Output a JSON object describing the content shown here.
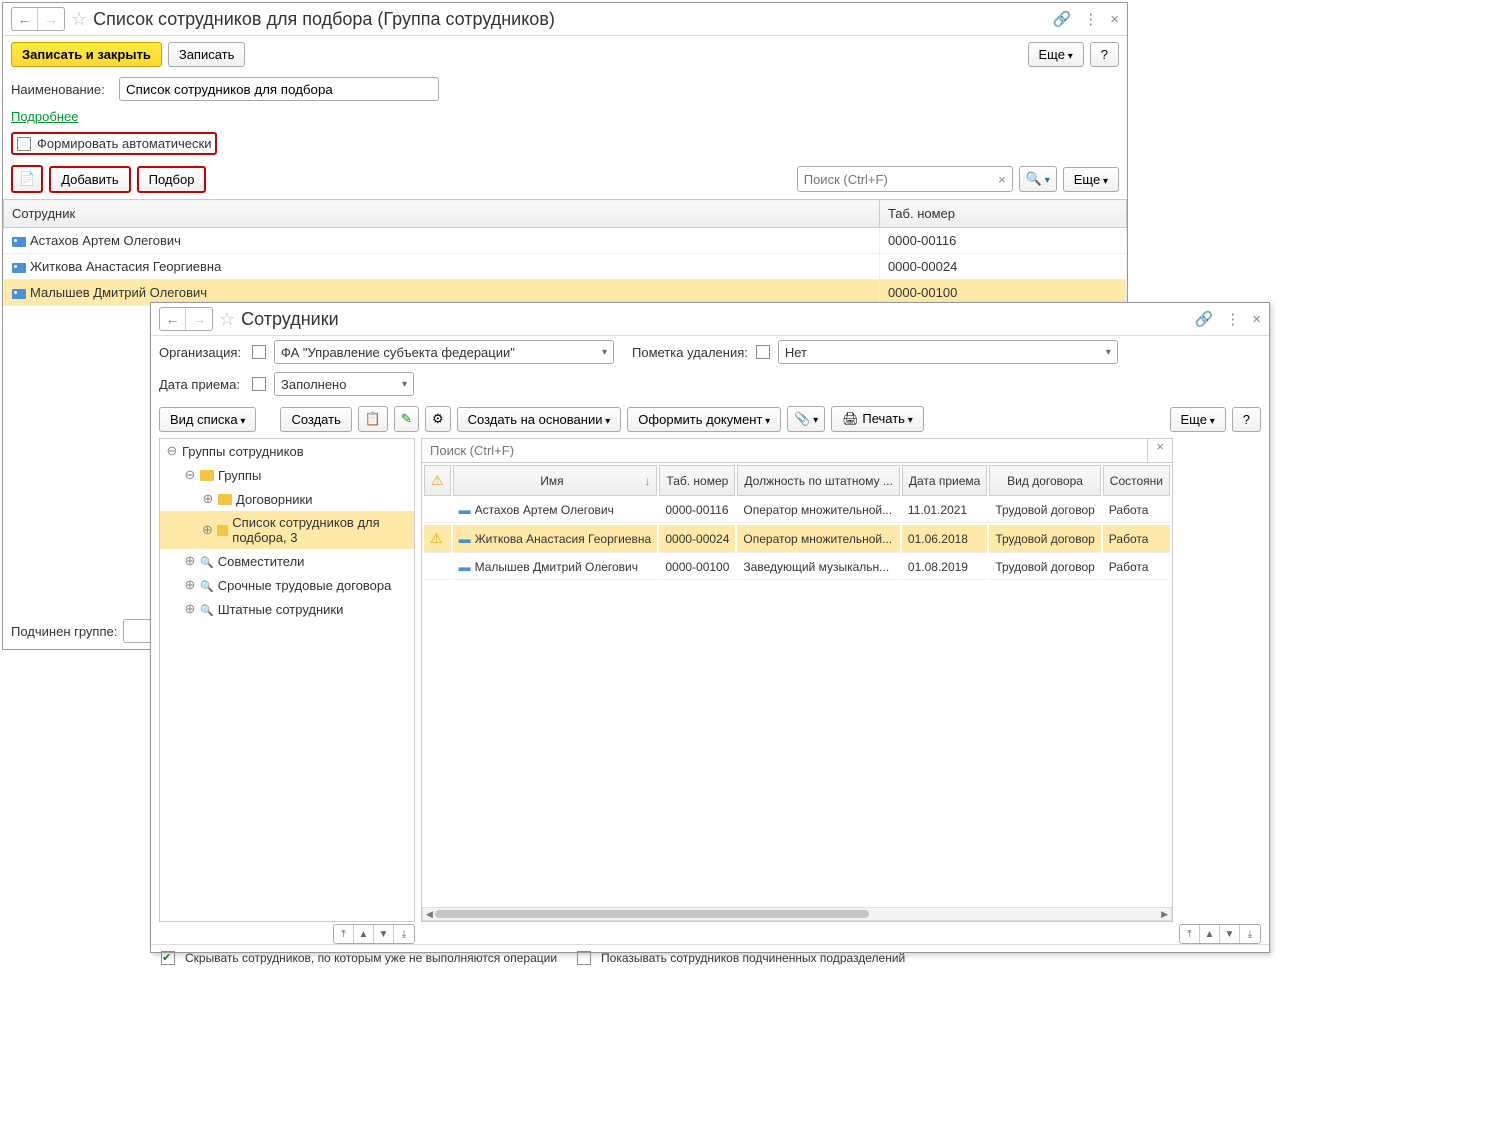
{
  "win1": {
    "title": "Список сотрудников для подбора (Группа сотрудников)",
    "save_close": "Записать и закрыть",
    "save": "Записать",
    "more": "Еще",
    "name_label": "Наименование:",
    "name_value": "Список сотрудников для подбора",
    "details_link": "Подробнее",
    "auto_label": "Формировать автоматически",
    "add": "Добавить",
    "pick": "Подбор",
    "search_ph": "Поиск (Ctrl+F)",
    "col_emp": "Сотрудник",
    "col_tab": "Таб. номер",
    "rows": [
      {
        "name": "Астахов Артем Олегович",
        "tab": "0000-00116"
      },
      {
        "name": "Житкова Анастасия Георгиевна",
        "tab": "0000-00024"
      },
      {
        "name": "Малышев Дмитрий Олегович",
        "tab": "0000-00100"
      }
    ],
    "group_label": "Подчинен группе:"
  },
  "win2": {
    "title": "Сотрудники",
    "org_label": "Организация:",
    "org_value": "ФА \"Управление субъекта федерации\"",
    "del_label": "Пометка удаления:",
    "del_value": "Нет",
    "hired_label": "Дата приема:",
    "hired_value": "Заполнено",
    "listview": "Вид списка",
    "create": "Создать",
    "create_based": "Создать на основании",
    "make_doc": "Оформить документ",
    "print": "Печать",
    "more": "Еще",
    "search_ph": "Поиск (Ctrl+F)",
    "tree": {
      "root": "Группы сотрудников",
      "items": [
        {
          "label": "Группы",
          "depth": 1,
          "folder": true,
          "exp": "⊖"
        },
        {
          "label": "Договорники",
          "depth": 2,
          "folder": true,
          "exp": "⊕"
        },
        {
          "label": "Список сотрудников для подбора, 3",
          "depth": 2,
          "folder": true,
          "exp": "⊕",
          "sel": true
        },
        {
          "label": "Совместители",
          "depth": 1,
          "lens": true,
          "exp": "⊕"
        },
        {
          "label": "Срочные трудовые договора",
          "depth": 1,
          "lens": true,
          "exp": "⊕"
        },
        {
          "label": "Штатные сотрудники",
          "depth": 1,
          "lens": true,
          "exp": "⊕"
        }
      ]
    },
    "cols": [
      "Имя",
      "Таб. номер",
      "Должность по штатному ...",
      "Дата приема",
      "Вид договора",
      "Состояни"
    ],
    "rows": [
      {
        "name": "Астахов Артем Олегович",
        "tab": "0000-00116",
        "pos": "Оператор множительной...",
        "date": "11.01.2021",
        "contract": "Трудовой договор",
        "state": "Работа"
      },
      {
        "name": "Житкова Анастасия Георгиевна",
        "tab": "0000-00024",
        "pos": "Оператор множительной...",
        "date": "01.06.2018",
        "contract": "Трудовой договор",
        "state": "Работа",
        "sel": true,
        "warn": true
      },
      {
        "name": "Малышев Дмитрий Олегович",
        "tab": "0000-00100",
        "pos": "Заведующий музыкальн...",
        "date": "01.08.2019",
        "contract": "Трудовой договор",
        "state": "Работа"
      }
    ],
    "hide_label": "Скрывать сотрудников, по которым уже не выполняются операции",
    "show_sub_label": "Показывать сотрудников подчиненных подразделений"
  }
}
